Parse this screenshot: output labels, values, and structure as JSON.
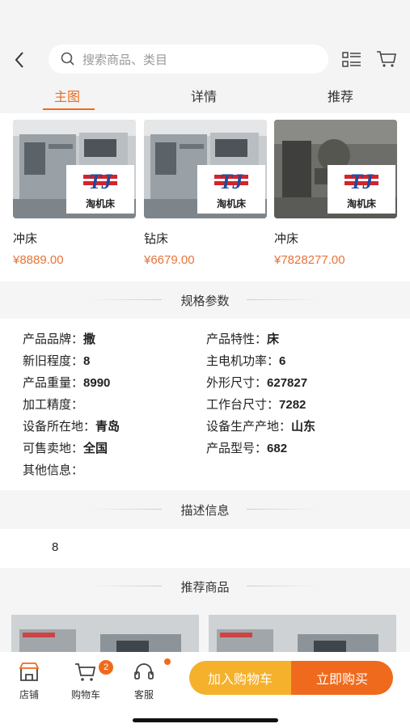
{
  "header": {
    "search_placeholder": "搜索商品、类目"
  },
  "tabs": [
    {
      "label": "主图",
      "active": true
    },
    {
      "label": "详情",
      "active": false
    },
    {
      "label": "推荐",
      "active": false
    }
  ],
  "products": [
    {
      "name": "冲床",
      "price": "¥8889.00",
      "logo_text": "淘机床"
    },
    {
      "name": "钻床",
      "price": "¥6679.00",
      "logo_text": "淘机床"
    },
    {
      "name": "冲床",
      "price": "¥7828277.00",
      "logo_text": "淘机床"
    }
  ],
  "specs_section": {
    "title": "规格参数",
    "rows": [
      {
        "label": "产品品牌：",
        "value": "撒"
      },
      {
        "label": "产品特性：",
        "value": "床"
      },
      {
        "label": "新旧程度：",
        "value": "8"
      },
      {
        "label": "主电机功率：",
        "value": "6"
      },
      {
        "label": "产品重量：",
        "value": "8990"
      },
      {
        "label": "外形尺寸：",
        "value": "627827"
      },
      {
        "label": "加工精度：",
        "value": ""
      },
      {
        "label": "工作台尺寸：",
        "value": "7282"
      },
      {
        "label": "设备所在地：",
        "value": "青岛"
      },
      {
        "label": "设备生产产地：",
        "value": "山东"
      },
      {
        "label": "可售卖地：",
        "value": "全国"
      },
      {
        "label": "产品型号：",
        "value": "682"
      },
      {
        "label": "其他信息：",
        "value": ""
      }
    ]
  },
  "description_section": {
    "title": "描述信息",
    "text": "8"
  },
  "recommend_section": {
    "title": "推荐商品"
  },
  "bottom_bar": {
    "store_label": "店铺",
    "cart_label": "购物车",
    "cart_badge": "2",
    "service_label": "客服",
    "add_to_cart_label": "加入购物车",
    "buy_now_label": "立即购买"
  },
  "colors": {
    "accent": "#f06a1d",
    "secondary": "#f5b12c",
    "price": "#e8733a"
  }
}
